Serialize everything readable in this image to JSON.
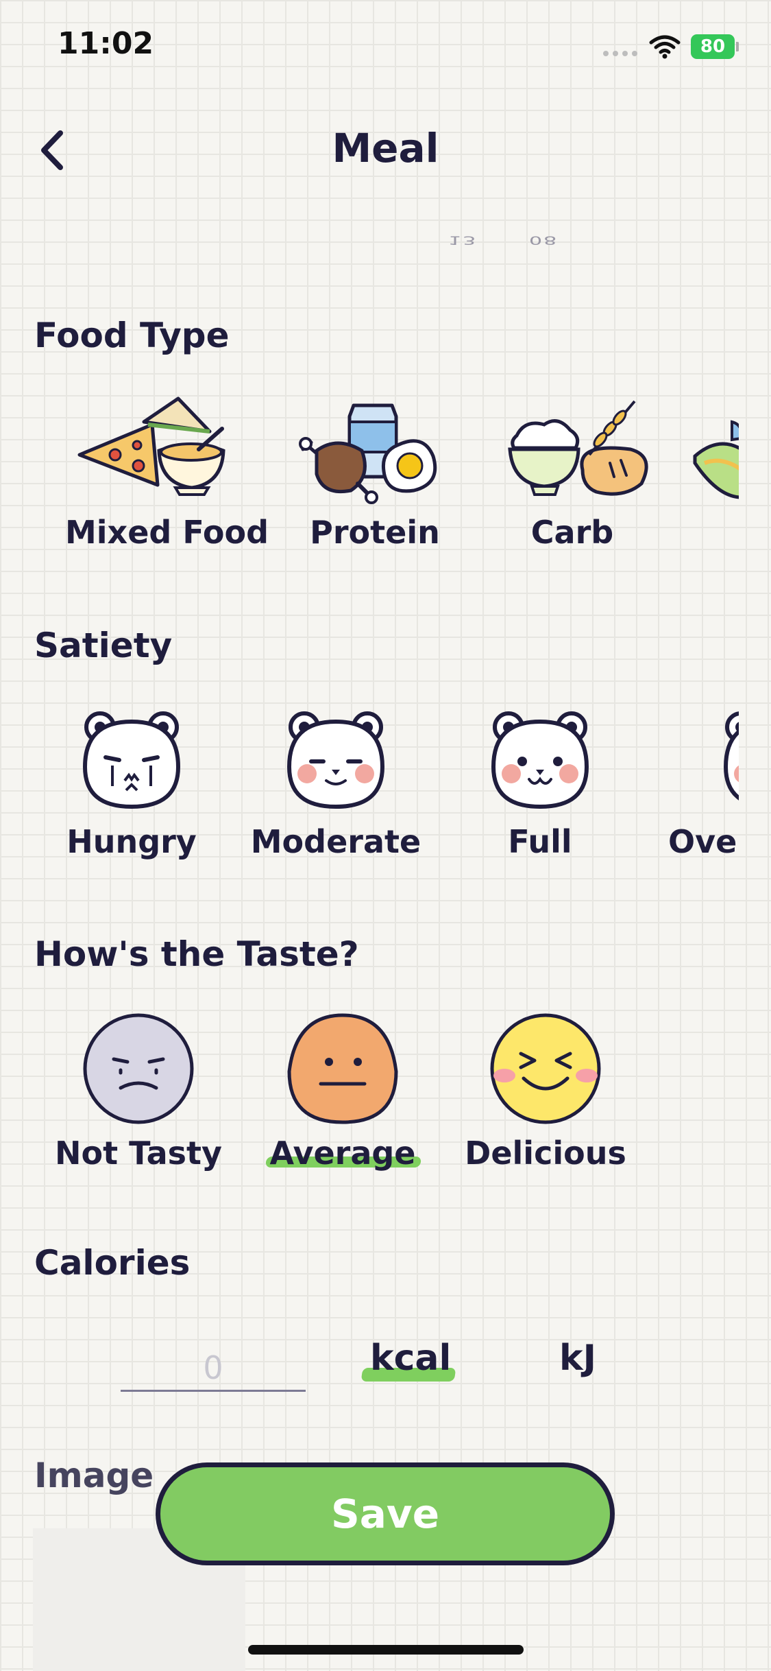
{
  "status_bar": {
    "time": "11:02",
    "battery": "80"
  },
  "header": {
    "title": "Meal",
    "date_fragments": [
      "13",
      "08"
    ]
  },
  "food_type": {
    "title": "Food Type",
    "items": [
      {
        "label": "Mixed Food",
        "icon": "mixed-food-icon"
      },
      {
        "label": "Protein",
        "icon": "protein-icon"
      },
      {
        "label": "Carb",
        "icon": "carb-icon"
      },
      {
        "label": "",
        "icon": "vegetable-icon"
      }
    ]
  },
  "satiety": {
    "title": "Satiety",
    "items": [
      {
        "label": "Hungry",
        "icon": "hungry-bear-icon"
      },
      {
        "label": "Moderate",
        "icon": "moderate-bear-icon"
      },
      {
        "label": "Full",
        "icon": "full-bear-icon"
      },
      {
        "label": "Over",
        "icon": "overfull-bear-icon"
      }
    ]
  },
  "taste": {
    "title": "How's the Taste?",
    "items": [
      {
        "label": "Not Tasty",
        "icon": "not-tasty-face-icon"
      },
      {
        "label": "Average",
        "icon": "average-face-icon",
        "selected": true
      },
      {
        "label": "Delicious",
        "icon": "delicious-face-icon"
      }
    ]
  },
  "calories": {
    "title": "Calories",
    "placeholder": "0",
    "units": [
      {
        "label": "kcal",
        "selected": true
      },
      {
        "label": "kJ"
      }
    ]
  },
  "image": {
    "title": "Image"
  },
  "save": {
    "label": "Save"
  },
  "colors": {
    "accent": "#82cb62",
    "highlight": "#7fcf5e",
    "text": "#1f1d3d",
    "background": "#f6f5f1"
  }
}
